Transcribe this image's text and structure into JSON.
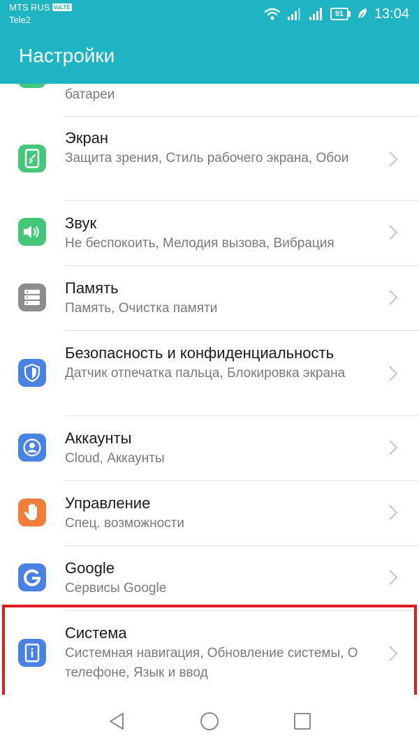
{
  "status_bar": {
    "carrier_primary": "MTS RUS",
    "carrier_badge": "VoLTE",
    "carrier_secondary": "Tele2",
    "icons": [
      "wifi-icon",
      "signal-icon",
      "signal-icon",
      "battery-icon",
      "leaf-icon"
    ],
    "battery_level": "91",
    "time": "13:04"
  },
  "app_bar": {
    "title": "Настройки"
  },
  "list": {
    "partial_item": {
      "subtitle": "батареи"
    },
    "items": [
      {
        "title": "Экран",
        "subtitle": "Защита зрения, Стиль рабочего экрана, Обои",
        "icon": "screen-icon",
        "color": "#45c77a"
      },
      {
        "title": "Звук",
        "subtitle": "Не беспокоить, Мелодия вызова, Вибрация",
        "icon": "speaker-icon",
        "color": "#45c77a"
      },
      {
        "title": "Память",
        "subtitle": "Память, Очистка памяти",
        "icon": "storage-icon",
        "color": "#8d8d8d"
      },
      {
        "title": "Безопасность и конфиденциальность",
        "subtitle": "Датчик отпечатка пальца, Блокировка экрана",
        "icon": "shield-icon",
        "color": "#4a82e3"
      },
      {
        "title": "Аккаунты",
        "subtitle": "Cloud, Аккаунты",
        "icon": "account-icon",
        "color": "#4a82e3"
      },
      {
        "title": "Управление",
        "subtitle": "Спец. возможности",
        "icon": "hand-icon",
        "color": "#f07d39"
      },
      {
        "title": "Google",
        "subtitle": "Сервисы Google",
        "icon": "google-icon",
        "color": "#4a82e3"
      },
      {
        "title": "Система",
        "subtitle": "Системная навигация, Обновление системы, О телефоне, Язык и ввод",
        "icon": "info-icon",
        "color": "#4a82e3"
      }
    ]
  },
  "highlight": {
    "color": "#e01b22",
    "target": "Система"
  },
  "nav_bar": {
    "icons": [
      "back-icon",
      "home-icon",
      "recents-icon"
    ]
  },
  "colors": {
    "accent": "#1fb4c3"
  }
}
